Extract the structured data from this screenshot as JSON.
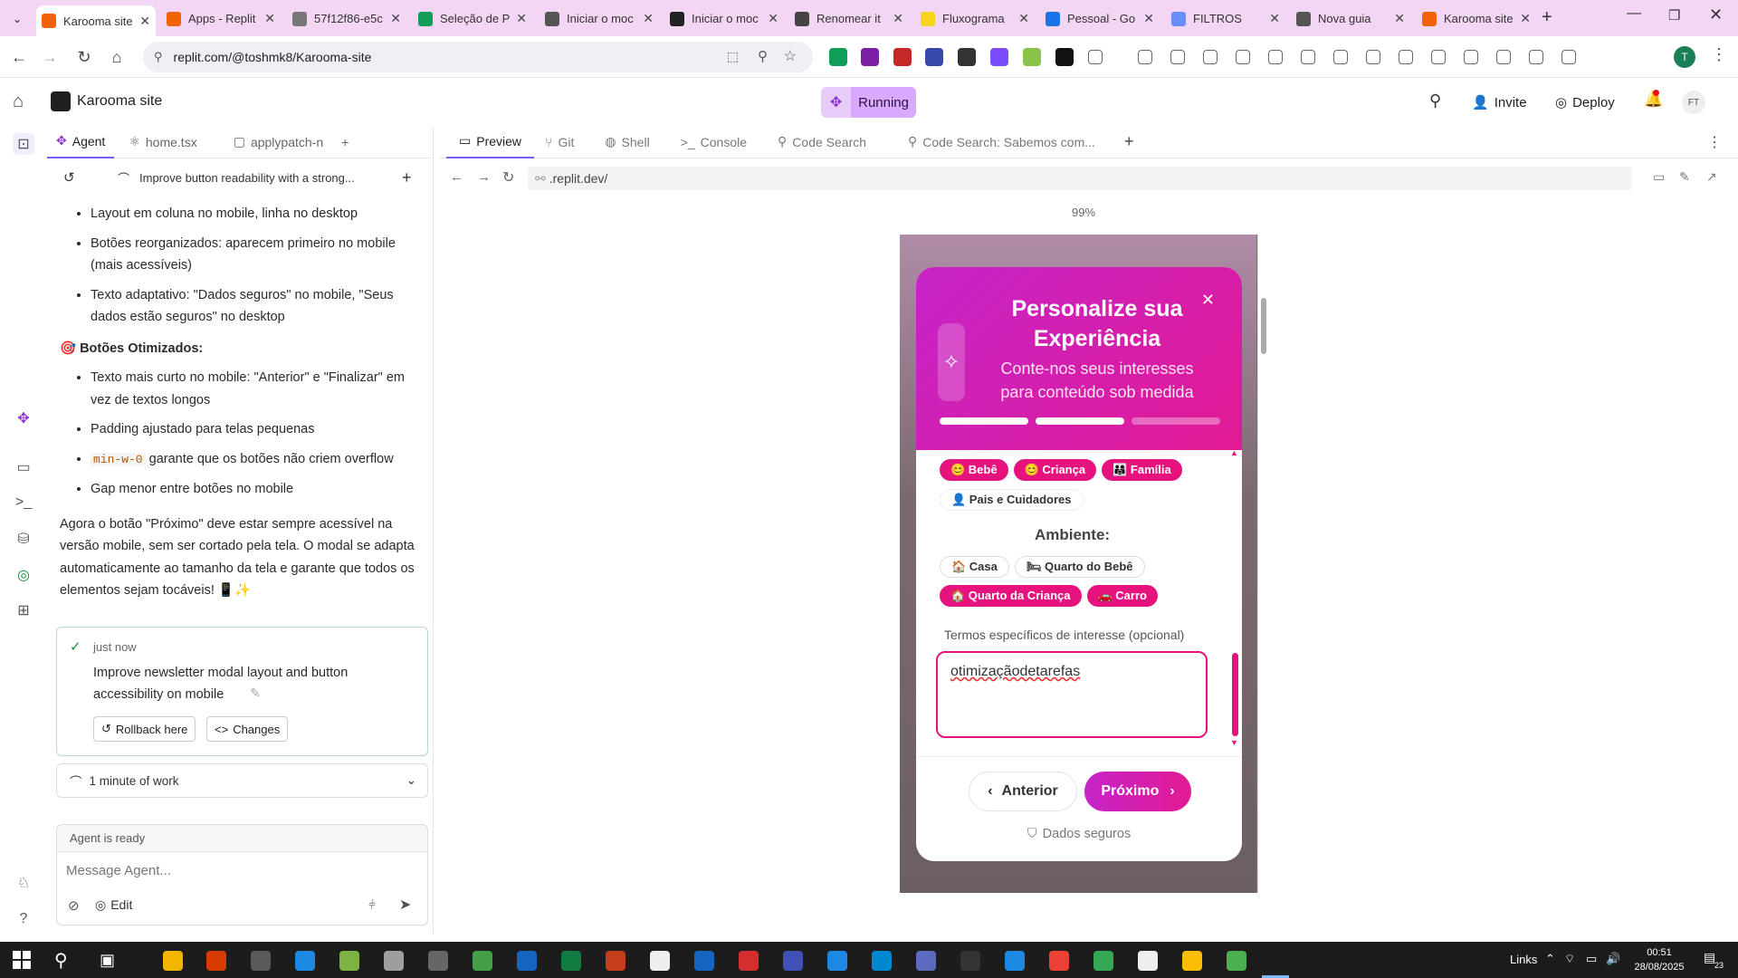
{
  "browser": {
    "tabs": [
      {
        "title": "Karooma site",
        "color": "#f26207",
        "active": true
      },
      {
        "title": "Apps - Replit",
        "color": "#f26207"
      },
      {
        "title": "57f12f86-e5c",
        "color": "#777"
      },
      {
        "title": "Seleção de P",
        "color": "#0f9d58"
      },
      {
        "title": "Iniciar o moc",
        "color": "#555"
      },
      {
        "title": "Iniciar o moc",
        "color": "#222"
      },
      {
        "title": "Renomear it",
        "color": "#444"
      },
      {
        "title": "Fluxograma",
        "color": "#f7d31a"
      },
      {
        "title": "Pessoal - Go",
        "color": "#1a73e8"
      },
      {
        "title": "FILTROS",
        "color": "#6a8cff"
      },
      {
        "title": "Nova guia",
        "color": "#555"
      },
      {
        "title": "Karooma site",
        "color": "#f26207"
      }
    ],
    "url": "replit.com/@toshmk8/Karooma-site"
  },
  "replit": {
    "project": "Karooma site",
    "status": "Running",
    "invite": "Invite",
    "deploy": "Deploy",
    "avatar": "FT",
    "left_tabs": [
      "Agent",
      "home.tsx",
      "applypatch-n"
    ],
    "right_tabs": [
      "Preview",
      "Git",
      "Shell",
      "Console",
      "Code Search",
      "Code Search: Sabemos com..."
    ],
    "preview_url": ".replit.dev/",
    "zoom": "99%"
  },
  "agent": {
    "thread_title": "Improve button readability with a strong...",
    "list1": [
      "Layout em coluna no mobile, linha no desktop",
      "Botões reorganizados: aparecem primeiro no mobile (mais acessíveis)",
      "Texto adaptativo: \"Dados seguros\" no mobile, \"Seus dados estão seguros\" no desktop"
    ],
    "heading": "🎯 Botões Otimizados:",
    "list2a": "Texto mais curto no mobile: \"Anterior\" e \"Finalizar\" em vez de textos longos",
    "list2b": "Padding ajustado para telas pequenas",
    "list2c_code": "min-w-0",
    "list2c_text": "garante que os botões não criem overflow",
    "list2d": "Gap menor entre botões no mobile",
    "para": "Agora o botão \"Próximo\" deve estar sempre acessível na versão mobile, sem ser cortado pela tela. O modal se adapta automaticamente ao tamanho da tela e garante que todos os elementos sejam tocáveis! 📱✨",
    "checkpoint_time": "just now",
    "checkpoint_msg": "Improve newsletter modal layout and button accessibility on mobile",
    "rollback": "Rollback here",
    "changes": "Changes",
    "work": "1 minute of work",
    "ready": "Agent is ready",
    "input_placeholder": "Message Agent...",
    "edit": "Edit"
  },
  "modal": {
    "title1": "Personalize sua",
    "title2": "Experiência",
    "subtitle1": "Conte-nos seus interesses",
    "subtitle2": "para conteúdo sob medida",
    "progress": [
      1,
      1,
      0
    ],
    "chips_top": [
      {
        "label": "😊 Bebê",
        "on": true
      },
      {
        "label": "😊 Criança",
        "on": true
      },
      {
        "label": "👨‍👩‍👧 Família",
        "on": true
      }
    ],
    "chip_pais": "👤 Pais e Cuidadores",
    "ambiente": "Ambiente:",
    "env_chips_1": [
      {
        "label": "🏠 Casa",
        "on": false
      },
      {
        "label": "🛏 Quarto do Bebê",
        "on": false
      }
    ],
    "env_chips_2": [
      {
        "label": "🏠 Quarto da Criança",
        "on": true
      },
      {
        "label": "🚗 Carro",
        "on": true
      }
    ],
    "terms_label": "Termos específicos de interesse (opcional)",
    "terms_value": "otimizaçãodetarefas",
    "prev": "Anterior",
    "next": "Próximo",
    "secure": "Dados seguros"
  },
  "taskbar": {
    "links": "Links",
    "time": "00:51",
    "date": "28/08/2025",
    "notif": "23"
  }
}
